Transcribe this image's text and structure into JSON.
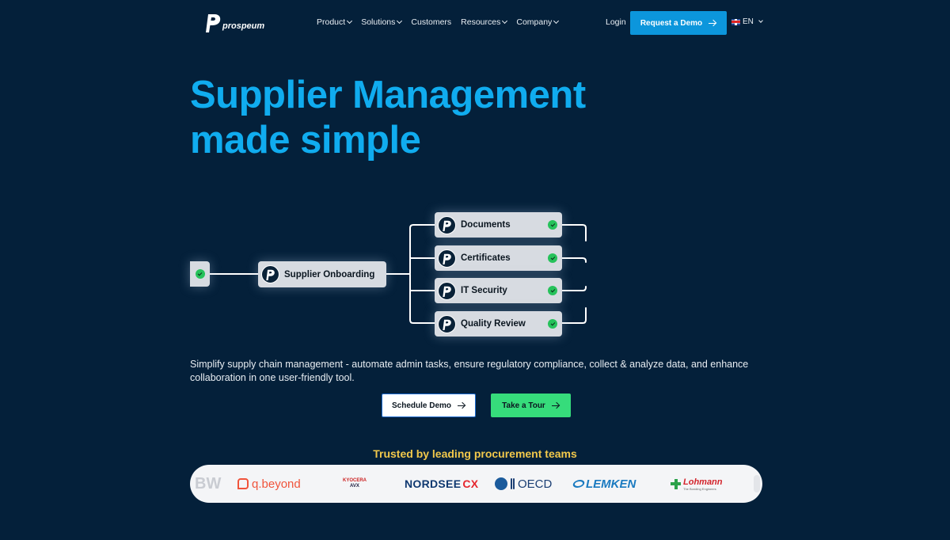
{
  "nav": {
    "logo_text": "prospeum",
    "menu": [
      {
        "label": "Product",
        "has_dropdown": true
      },
      {
        "label": "Solutions",
        "has_dropdown": true
      },
      {
        "label": "Customers",
        "has_dropdown": false
      },
      {
        "label": "Resources",
        "has_dropdown": true
      },
      {
        "label": "Company",
        "has_dropdown": true
      }
    ],
    "login": "Login",
    "demo_button": "Request a Demo",
    "language": "EN",
    "language_flag_icon": "uk-flag-icon"
  },
  "hero": {
    "title_line1": "Supplier Management",
    "title_line2": "made simple"
  },
  "flow": {
    "main_node": "Supplier Onboarding",
    "steps": [
      {
        "label": "Documents",
        "status": "complete"
      },
      {
        "label": "Certificates",
        "status": "complete"
      },
      {
        "label": "IT Security",
        "status": "complete"
      },
      {
        "label": "Quality Review",
        "status": "complete"
      }
    ]
  },
  "description": "Simplify supply chain management - automate admin tasks, ensure regulatory compliance, collect & analyze data, and enhance collaboration in one user-friendly tool.",
  "cta": {
    "schedule": "Schedule Demo",
    "tour": "Take a Tour"
  },
  "trusted": {
    "heading": "Trusted by leading procurement teams",
    "logos": {
      "bw": "BW",
      "qbeyond": "q.beyond",
      "kyocera_top": "KYOCERA",
      "kyocera_bottom": "AVX",
      "nordsee": "NORDSEE",
      "nordsee_mark": "CX",
      "oecd": "OECD",
      "lemken": "LEMKEN",
      "lohmann": "Lohmann",
      "lohmann_tagline": "The Bonding Engineers"
    }
  },
  "colors": {
    "background": "#04203a",
    "accent_blue": "#10acef",
    "button_blue": "#0c96dc",
    "cta_green": "#36dc7b",
    "trusted_yellow": "#f2c84b",
    "check_green": "#26c25b"
  }
}
